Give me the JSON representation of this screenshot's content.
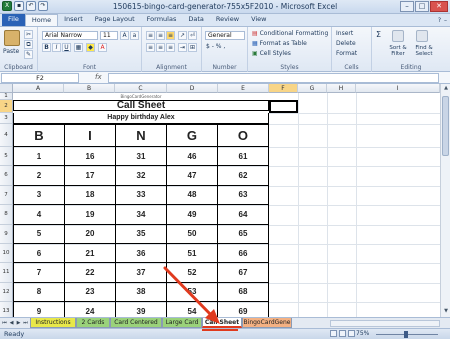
{
  "window": {
    "title": "150615-bingo-card-generator-755x5F2010 - Microsoft Excel",
    "buttons": {
      "min": "–",
      "max": "□",
      "close": "✕"
    }
  },
  "quick_access": [
    "save-icon",
    "undo-icon",
    "redo-icon"
  ],
  "ribbon_tabs": [
    "File",
    "Home",
    "Insert",
    "Page Layout",
    "Formulas",
    "Data",
    "Review",
    "View"
  ],
  "active_tab": "Home",
  "ribbon": {
    "clipboard": {
      "paste": "Paste",
      "group": "Clipboard"
    },
    "font": {
      "name": "Arial Narrow",
      "size": "11",
      "group": "Font",
      "bold": "B",
      "italic": "I",
      "underline": "U"
    },
    "alignment": {
      "group": "Alignment"
    },
    "number": {
      "format": "General",
      "currency": "$ - % ,",
      "group": "Number"
    },
    "styles": {
      "conditional": "Conditional Formatting",
      "format_table": "Format as Table",
      "cell_styles": "Cell Styles",
      "group": "Styles"
    },
    "cells": {
      "insert": "Insert",
      "delete": "Delete",
      "format": "Format",
      "group": "Cells"
    },
    "editing": {
      "sigma": "Σ",
      "sort": "Sort & Filter",
      "find": "Find & Select",
      "group": "Editing"
    }
  },
  "formula_bar": {
    "name_box": "F2",
    "fx": "fx",
    "value": ""
  },
  "columns": [
    "A",
    "B",
    "C",
    "D",
    "E",
    "F",
    "G",
    "H",
    "I"
  ],
  "rows": [
    "1",
    "2",
    "3",
    "4",
    "5",
    "6",
    "7",
    "8",
    "9",
    "10",
    "11",
    "12",
    "13"
  ],
  "sheet": {
    "tiny_text": "BingoCardGenerator",
    "title": "Call Sheet",
    "subtitle": "Happy birthday Alex",
    "headers": [
      "B",
      "I",
      "N",
      "G",
      "O"
    ],
    "grid": [
      [
        "1",
        "16",
        "31",
        "46",
        "61"
      ],
      [
        "2",
        "17",
        "32",
        "47",
        "62"
      ],
      [
        "3",
        "18",
        "33",
        "48",
        "63"
      ],
      [
        "4",
        "19",
        "34",
        "49",
        "64"
      ],
      [
        "5",
        "20",
        "35",
        "50",
        "65"
      ],
      [
        "6",
        "21",
        "36",
        "51",
        "66"
      ],
      [
        "7",
        "22",
        "37",
        "52",
        "67"
      ],
      [
        "8",
        "23",
        "38",
        "53",
        "68"
      ],
      [
        "9",
        "24",
        "39",
        "54",
        "69"
      ]
    ]
  },
  "sheet_tabs": [
    {
      "label": "Instructions",
      "color": "#e8e84a"
    },
    {
      "label": "2 Cards",
      "color": "#9ad27a"
    },
    {
      "label": "Card Centered",
      "color": "#9ad27a"
    },
    {
      "label": "Large Card",
      "color": "#9ad27a"
    },
    {
      "label": "Call Sheet",
      "color": "#ffffff"
    },
    {
      "label": "BingoCardGene",
      "color": "#f4b183"
    }
  ],
  "status": {
    "ready": "Ready",
    "zoom": "75%",
    "minus": "−",
    "plus": "+"
  },
  "colors": {
    "accent": "#2a62b6",
    "arrow": "#e03a1e"
  }
}
